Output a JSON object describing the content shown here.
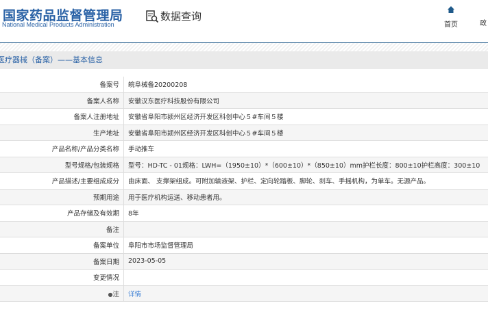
{
  "header": {
    "logo_cn": "国家药品监督管理局",
    "logo_en": "National Medical Products Administration",
    "query": "数据查询",
    "nav": [
      {
        "label": "首页"
      },
      {
        "label": "政"
      }
    ]
  },
  "section_title": "医疗器械（备案）——基本信息",
  "rows": [
    {
      "label": "备案号",
      "value": "皖阜械备20200208"
    },
    {
      "label": "备案人名称",
      "value": "安徽汉东医疗科技股份有限公司"
    },
    {
      "label": "备案人注册地址",
      "value": "安徽省阜阳市颍州区经济开发区科创中心５#车间５楼"
    },
    {
      "label": "生产地址",
      "value": "安徽省阜阳市颍州区经济开发区科创中心５#车间５楼"
    },
    {
      "label": "产品名称/产品分类名称",
      "value": "手动推车"
    },
    {
      "label": "型号规格/包装规格",
      "value": "型号：HD-TC - 01规格：LWH=（1950±10）*（600±10）*（850±10）mm护栏长度：800±10护栏高度：300±10"
    },
    {
      "label": "产品描述/主要组成成分",
      "value": "由床面、 支撑架组成。可附加输液架、护栏、定向轮踏板、脚轮、刹车、手摇机构，为单车。无源产品。"
    },
    {
      "label": "预期用途",
      "value": "用于医疗机构运送、移动患者用。"
    },
    {
      "label": "产品存储及有效期",
      "value": "8年"
    },
    {
      "label": "备注",
      "value": ""
    },
    {
      "label": "备案单位",
      "value": "阜阳市市场监督管理局"
    },
    {
      "label": "备案日期",
      "value": "2023-05-05"
    },
    {
      "label": "变更情况",
      "value": ""
    },
    {
      "label": "注",
      "value": "详情"
    }
  ]
}
